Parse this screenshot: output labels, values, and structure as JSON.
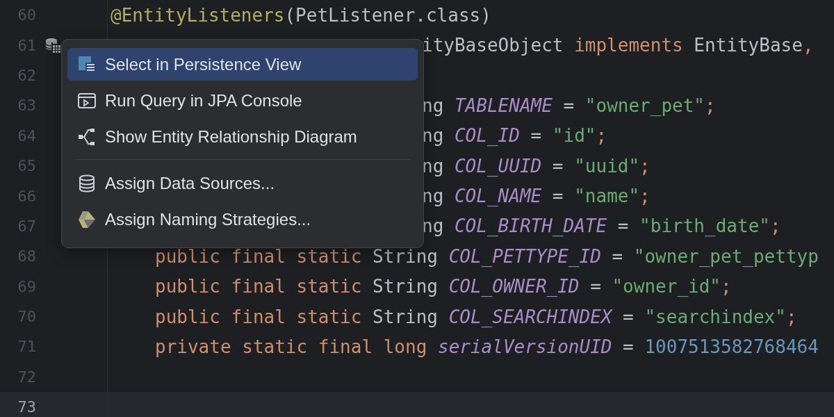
{
  "editor": {
    "lines": [
      {
        "number": "60",
        "indented": false,
        "covered": false,
        "current": false,
        "gutter_icon": false,
        "tokens": [
          {
            "kind": "annotation",
            "text": "@EntityListeners"
          },
          {
            "kind": "plain",
            "text": "(PetListener.class)"
          }
        ]
      },
      {
        "number": "61",
        "covered": true,
        "current": false,
        "gutter_icon": true,
        "tokens": [
          {
            "kind": "plain",
            "text": "ityBaseObject "
          },
          {
            "kind": "keyword",
            "text": "implements"
          },
          {
            "kind": "plain",
            "text": " EntityBase"
          },
          {
            "kind": "keyword",
            "text": ","
          }
        ]
      },
      {
        "number": "62",
        "current": false,
        "gutter_icon": false
      },
      {
        "number": "63",
        "covered": true,
        "current": false,
        "gutter_icon": false,
        "tokens": [
          {
            "kind": "plain",
            "text": "ng "
          },
          {
            "kind": "field",
            "text": "TABLENAME"
          },
          {
            "kind": "plain",
            "text": " = "
          },
          {
            "kind": "string",
            "text": "\"owner_pet\""
          },
          {
            "kind": "keyword",
            "text": ";"
          }
        ]
      },
      {
        "number": "64",
        "covered": true,
        "current": false,
        "gutter_icon": false,
        "tokens": [
          {
            "kind": "plain",
            "text": "ng "
          },
          {
            "kind": "field",
            "text": "COL_ID"
          },
          {
            "kind": "plain",
            "text": " = "
          },
          {
            "kind": "string",
            "text": "\"id\""
          },
          {
            "kind": "keyword",
            "text": ";"
          }
        ]
      },
      {
        "number": "65",
        "covered": true,
        "current": false,
        "gutter_icon": false,
        "tokens": [
          {
            "kind": "plain",
            "text": "ng "
          },
          {
            "kind": "field",
            "text": "COL_UUID"
          },
          {
            "kind": "plain",
            "text": " = "
          },
          {
            "kind": "string",
            "text": "\"uuid\""
          },
          {
            "kind": "keyword",
            "text": ";"
          }
        ]
      },
      {
        "number": "66",
        "covered": true,
        "current": false,
        "gutter_icon": false,
        "tokens": [
          {
            "kind": "plain",
            "text": "ng "
          },
          {
            "kind": "field",
            "text": "COL_NAME"
          },
          {
            "kind": "plain",
            "text": " = "
          },
          {
            "kind": "string",
            "text": "\"name\""
          },
          {
            "kind": "keyword",
            "text": ";"
          }
        ]
      },
      {
        "number": "67",
        "covered": true,
        "current": false,
        "gutter_icon": false,
        "tokens": [
          {
            "kind": "plain",
            "text": "ng "
          },
          {
            "kind": "field",
            "text": "COL_BIRTH_DATE"
          },
          {
            "kind": "plain",
            "text": " = "
          },
          {
            "kind": "string",
            "text": "\"birth_date\""
          },
          {
            "kind": "keyword",
            "text": ";"
          }
        ]
      },
      {
        "number": "68",
        "indented": true,
        "covered": false,
        "current": false,
        "gutter_icon": false,
        "tokens": [
          {
            "kind": "keyword",
            "text": "public final static "
          },
          {
            "kind": "plain",
            "text": "String "
          },
          {
            "kind": "field",
            "text": "COL_PETTYPE_ID"
          },
          {
            "kind": "plain",
            "text": " = "
          },
          {
            "kind": "string",
            "text": "\"owner_pet_pettyp"
          }
        ]
      },
      {
        "number": "69",
        "indented": true,
        "covered": false,
        "current": false,
        "gutter_icon": false,
        "tokens": [
          {
            "kind": "keyword",
            "text": "public final static "
          },
          {
            "kind": "plain",
            "text": "String "
          },
          {
            "kind": "field",
            "text": "COL_OWNER_ID"
          },
          {
            "kind": "plain",
            "text": " = "
          },
          {
            "kind": "string",
            "text": "\"owner_id\""
          },
          {
            "kind": "keyword",
            "text": ";"
          }
        ]
      },
      {
        "number": "70",
        "indented": true,
        "covered": false,
        "current": false,
        "gutter_icon": false,
        "tokens": [
          {
            "kind": "keyword",
            "text": "public final static "
          },
          {
            "kind": "plain",
            "text": "String "
          },
          {
            "kind": "field",
            "text": "COL_SEARCHINDEX"
          },
          {
            "kind": "plain",
            "text": " = "
          },
          {
            "kind": "string",
            "text": "\"searchindex\""
          },
          {
            "kind": "keyword",
            "text": ";"
          }
        ]
      },
      {
        "number": "71",
        "indented": true,
        "covered": false,
        "current": false,
        "gutter_icon": false,
        "tokens": [
          {
            "kind": "keyword",
            "text": "private static final long "
          },
          {
            "kind": "field",
            "text": "serialVersionUID"
          },
          {
            "kind": "plain",
            "text": " = "
          },
          {
            "kind": "number",
            "text": "1007513582768464"
          }
        ]
      },
      {
        "number": "72",
        "current": false,
        "gutter_icon": false
      },
      {
        "number": "73",
        "current": true,
        "gutter_icon": false
      }
    ]
  },
  "context_menu": {
    "groups": [
      [
        {
          "label": "Select in Persistence View",
          "selected": true
        },
        {
          "label": "Run Query in JPA Console",
          "selected": false
        },
        {
          "label": "Show Entity Relationship Diagram",
          "selected": false
        }
      ],
      [
        {
          "label": "Assign Data Sources...",
          "selected": false
        },
        {
          "label": "Assign Naming Strategies...",
          "selected": false
        }
      ]
    ]
  }
}
